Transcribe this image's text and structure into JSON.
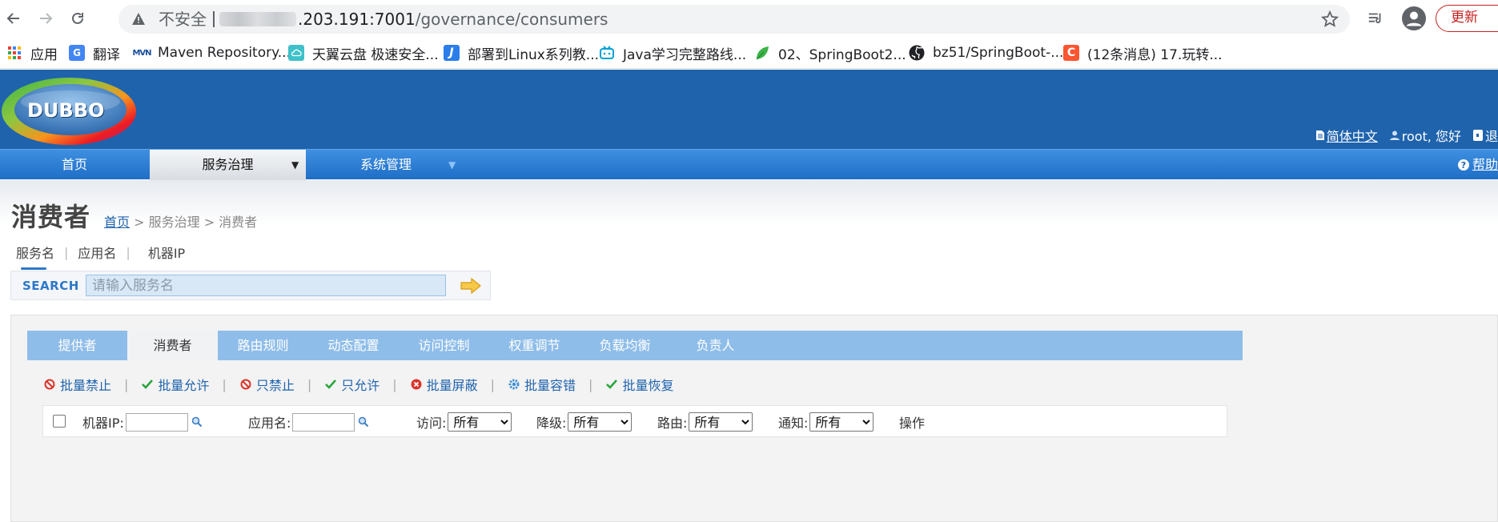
{
  "browser": {
    "not_secure": "不安全",
    "url_host_visible": ".203.191:7001",
    "url_path": "/governance/consumers",
    "update_label": "更新"
  },
  "bookmarks": [
    {
      "label": "应用",
      "icon": "apps-grid-icon"
    },
    {
      "label": "翻译",
      "icon": "translate-icon"
    },
    {
      "label": "Maven Repository...",
      "icon": "maven-icon"
    },
    {
      "label": "天翼云盘 极速安全...",
      "icon": "cloud-disk-icon"
    },
    {
      "label": "部署到Linux系列教...",
      "icon": "j-icon"
    },
    {
      "label": "Java学习完整路线...",
      "icon": "bilibili-icon"
    },
    {
      "label": "02、SpringBoot2...",
      "icon": "leaf-icon"
    },
    {
      "label": "bz51/SpringBoot-...",
      "icon": "github-icon"
    },
    {
      "label": "(12条消息) 17.玩转...",
      "icon": "csdn-icon"
    }
  ],
  "header": {
    "logo_text": "DUBBO",
    "lang_label": "简体中文",
    "user_greeting": "root, 您好",
    "logout_label": "退"
  },
  "main_nav": {
    "items": [
      "首页",
      "服务治理",
      "系统管理"
    ],
    "help_label": "帮助"
  },
  "page": {
    "title": "消费者",
    "breadcrumb_home": "首页",
    "breadcrumb_rest": "> 服务治理 > 消费者"
  },
  "search": {
    "tabs": [
      "服务名",
      "应用名",
      "机器IP"
    ],
    "label": "SEARCH",
    "placeholder": "请输入服务名"
  },
  "sub_tabs": [
    "提供者",
    "消费者",
    "路由规则",
    "动态配置",
    "访问控制",
    "权重调节",
    "负载均衡",
    "负责人"
  ],
  "actions": [
    {
      "label": "批量禁止",
      "icon": "forbid-icon"
    },
    {
      "label": "批量允许",
      "icon": "check-icon"
    },
    {
      "label": "只禁止",
      "icon": "forbid-icon"
    },
    {
      "label": "只允许",
      "icon": "check-icon"
    },
    {
      "label": "批量屏蔽",
      "icon": "block-icon"
    },
    {
      "label": "批量容错",
      "icon": "gear-icon"
    },
    {
      "label": "批量恢复",
      "icon": "check-icon"
    }
  ],
  "filters": {
    "machine_ip_label": "机器IP:",
    "app_name_label": "应用名:",
    "access_label": "访问:",
    "degrade_label": "降级:",
    "route_label": "路由:",
    "notify_label": "通知:",
    "select_value": "所有",
    "operation_label": "操作"
  }
}
